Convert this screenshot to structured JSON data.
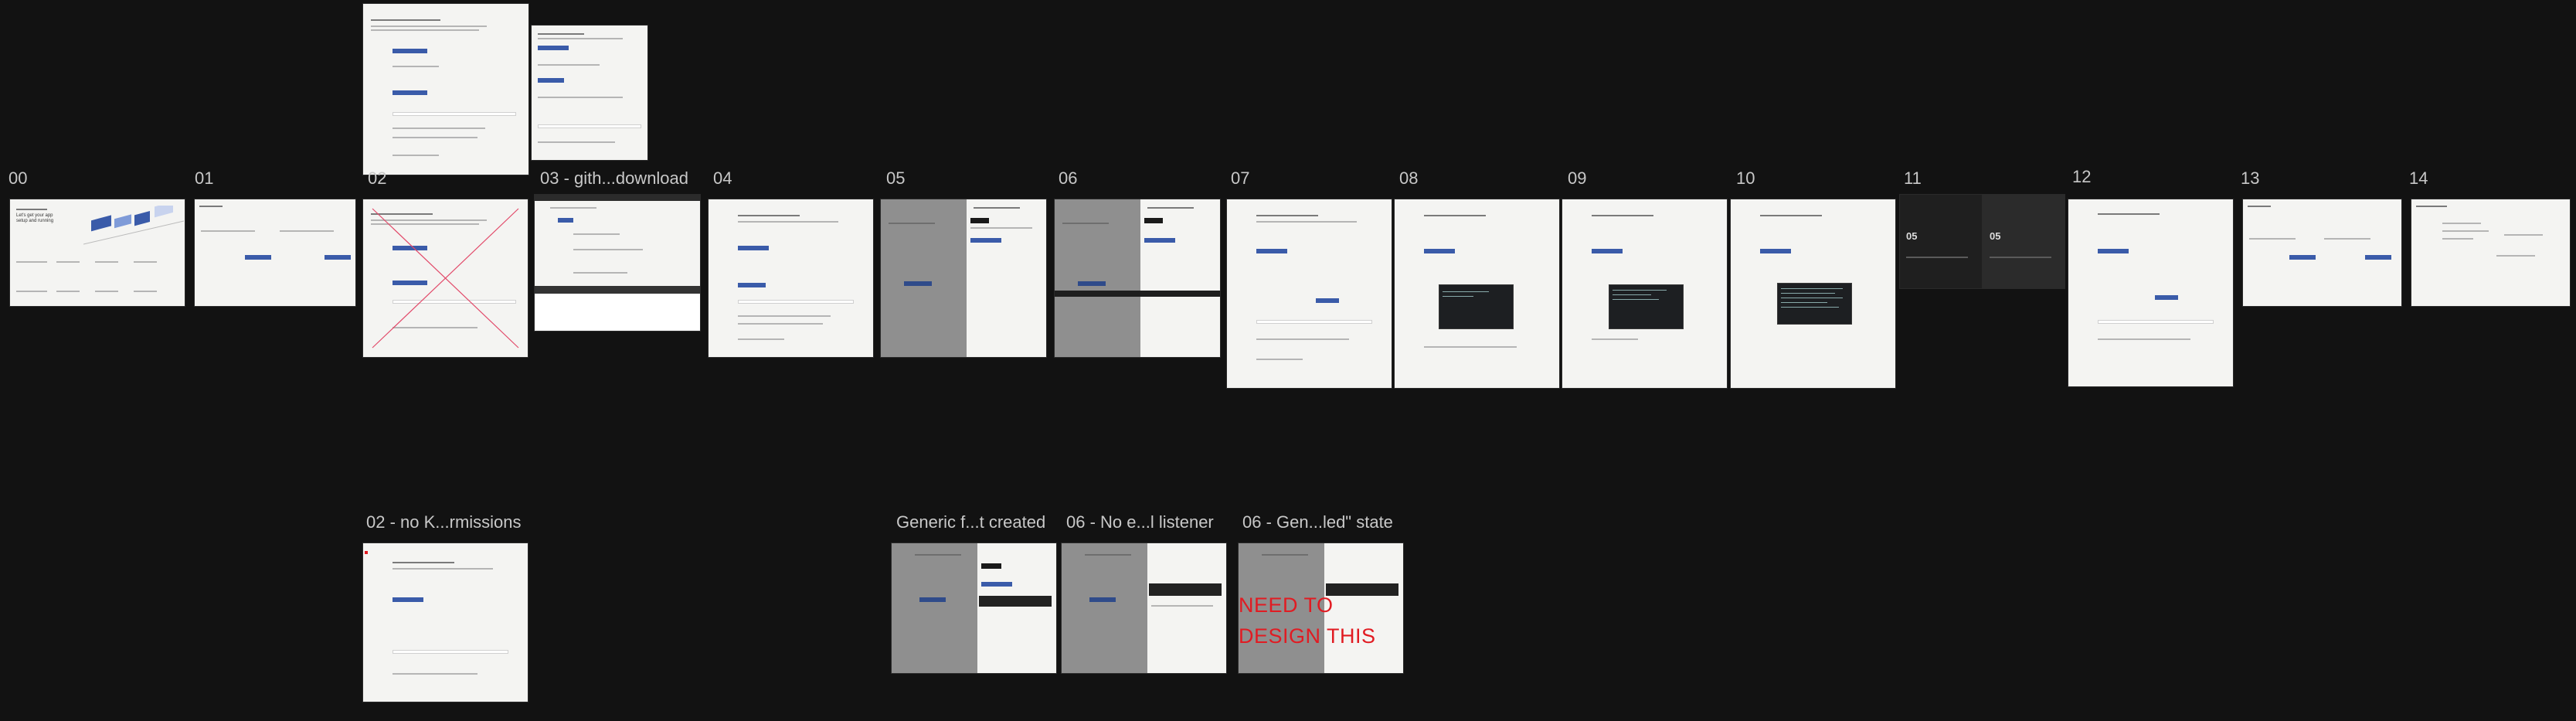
{
  "canvas": {
    "background": "#121212"
  },
  "frames": {
    "f00": {
      "label": "00",
      "hero": "Let's get your app setup and running"
    },
    "f01": {
      "label": "01"
    },
    "f02": {
      "label": "02"
    },
    "f03": {
      "label": "03 - gith...download"
    },
    "f04": {
      "label": "04"
    },
    "f05": {
      "label": "05"
    },
    "f06": {
      "label": "06"
    },
    "f07": {
      "label": "07"
    },
    "f08": {
      "label": "08"
    },
    "f09": {
      "label": "09"
    },
    "f10": {
      "label": "10"
    },
    "f11": {
      "label": "11",
      "big_number_a": "05",
      "big_number_b": "05"
    },
    "f12": {
      "label": "12"
    },
    "f13": {
      "label": "13"
    },
    "f14": {
      "label": "14"
    },
    "f02b": {
      "label": "02 - no K...rmissions"
    },
    "fGen": {
      "label": "Generic f...t created"
    },
    "f06b": {
      "label": "06 - No e...l listener"
    },
    "f06c": {
      "label": "06 - Gen...led\" state",
      "note": "NEED TO DESIGN THIS"
    }
  },
  "colors": {
    "accent": "#3a5ba9",
    "warning": "#e11b22",
    "frame_bg": "#f4f4f2"
  }
}
